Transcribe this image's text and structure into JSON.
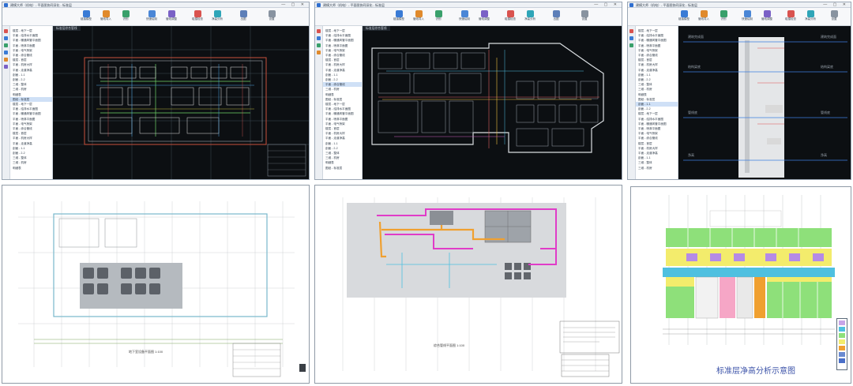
{
  "window": {
    "title": "建模大师（机电）- 平面图协同深化 - 标准层",
    "ribbon": [
      "链接模型",
      "管线导入",
      "识别",
      "快速绘制",
      "管线调整",
      "碰撞检查",
      "净高分析",
      "出图",
      "设置"
    ]
  },
  "tree_items": [
    "楼层 - 地下一层",
    "平面 - 给排水平面图",
    "平面 - 暖通风管平面图",
    "平面 - 喷淋平面图",
    "平面 - 电气桥架",
    "平面 - 综合管线",
    "楼层 - 首层",
    "平面 - 机房大样",
    "平面 - 走道净高",
    "剖面 - 1-1",
    "剖面 - 2-2",
    "三维 - 整体",
    "三维 - 机房",
    "明细表",
    "图纸 - 标准层"
  ],
  "view_tab": "标准层综合管线",
  "bottom_left": {
    "drawing_title": "地下室设备平面图 1:100"
  },
  "bottom_center": {
    "drawing_title": "综合管线平面图 1:100"
  },
  "bottom_right": {
    "caption": "标准层净高分析示意图"
  },
  "colors": {
    "magenta": "#e03cc8",
    "orange": "#f0a030",
    "cyan": "#4fc0e0",
    "green": "#8ee07a",
    "yellow": "#f3ec6c",
    "purple": "#b58be6",
    "pink": "#f6a6c6",
    "gray": "#9aa0a8",
    "blue_caption": "#3b52a8"
  },
  "legend_swatches": [
    "#c7a5e8",
    "#4fc0e0",
    "#8ee07a",
    "#f3ec6c",
    "#f0a030",
    "#6a8ad0",
    "#4a6fc8"
  ],
  "section_levels": [
    "建筑完成面",
    "结构梁底",
    "管线底",
    "净高"
  ]
}
